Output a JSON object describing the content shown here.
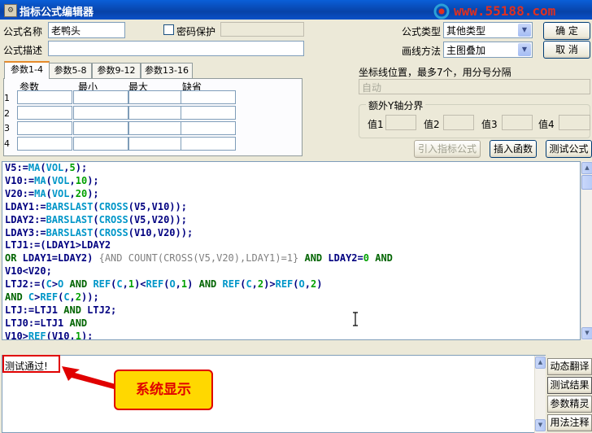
{
  "window": {
    "title": "指标公式编辑器",
    "watermark_url": "www.55188.com"
  },
  "form": {
    "name_label": "公式名称",
    "name_value": "老鸭头",
    "password_label": "密码保护",
    "desc_label": "公式描述",
    "type_label": "公式类型",
    "type_value": "其他类型",
    "draw_label": "画线方法",
    "draw_value": "主图叠加",
    "ok_label": "确  定",
    "cancel_label": "取  消"
  },
  "tabs": [
    "参数1-4",
    "参数5-8",
    "参数9-12",
    "参数13-16"
  ],
  "params": {
    "headers": [
      "参数",
      "最小",
      "最大",
      "缺省"
    ],
    "rows": [
      "1",
      "2",
      "3",
      "4"
    ]
  },
  "axis": {
    "coord_label": "坐标线位置，最多7个，用分号分隔",
    "coord_value": "自动",
    "extra_label": "额外Y轴分界",
    "values": [
      "值1",
      "值2",
      "值3",
      "值4"
    ]
  },
  "actions": {
    "import": "引入指标公式",
    "insert": "插入函数",
    "test": "测试公式"
  },
  "code": [
    [
      {
        "t": "V5:=",
        "c": "id"
      },
      {
        "t": "MA",
        "c": "fn"
      },
      {
        "t": "(",
        "c": "id"
      },
      {
        "t": "VOL",
        "c": "fn"
      },
      {
        "t": ",",
        "c": "id"
      },
      {
        "t": "5",
        "c": "num"
      },
      {
        "t": ");",
        "c": "id"
      }
    ],
    [
      {
        "t": "V10:=",
        "c": "id"
      },
      {
        "t": "MA",
        "c": "fn"
      },
      {
        "t": "(",
        "c": "id"
      },
      {
        "t": "VOL",
        "c": "fn"
      },
      {
        "t": ",",
        "c": "id"
      },
      {
        "t": "10",
        "c": "num"
      },
      {
        "t": ");",
        "c": "id"
      }
    ],
    [
      {
        "t": "V20:=",
        "c": "id"
      },
      {
        "t": "MA",
        "c": "fn"
      },
      {
        "t": "(",
        "c": "id"
      },
      {
        "t": "VOL",
        "c": "fn"
      },
      {
        "t": ",",
        "c": "id"
      },
      {
        "t": "20",
        "c": "num"
      },
      {
        "t": ");",
        "c": "id"
      }
    ],
    [
      {
        "t": "LDAY1:=",
        "c": "id"
      },
      {
        "t": "BARSLAST",
        "c": "fn"
      },
      {
        "t": "(",
        "c": "id"
      },
      {
        "t": "CROSS",
        "c": "fn"
      },
      {
        "t": "(V5,V10));",
        "c": "id"
      }
    ],
    [
      {
        "t": "LDAY2:=",
        "c": "id"
      },
      {
        "t": "BARSLAST",
        "c": "fn"
      },
      {
        "t": "(",
        "c": "id"
      },
      {
        "t": "CROSS",
        "c": "fn"
      },
      {
        "t": "(V5,V20));",
        "c": "id"
      }
    ],
    [
      {
        "t": "LDAY3:=",
        "c": "id"
      },
      {
        "t": "BARSLAST",
        "c": "fn"
      },
      {
        "t": "(",
        "c": "id"
      },
      {
        "t": "CROSS",
        "c": "fn"
      },
      {
        "t": "(V10,V20));",
        "c": "id"
      }
    ],
    [
      {
        "t": "LTJ1:=(LDAY1>LDAY2",
        "c": "id"
      }
    ],
    [
      {
        "t": "OR",
        "c": "kw"
      },
      {
        "t": " LDAY1=LDAY2) ",
        "c": "id"
      },
      {
        "t": "{AND COUNT(CROSS(V5,V20),LDAY1)=1}",
        "c": "cm"
      },
      {
        "t": " ",
        "c": "id"
      },
      {
        "t": "AND",
        "c": "kw"
      },
      {
        "t": " LDAY2=",
        "c": "id"
      },
      {
        "t": "0",
        "c": "num"
      },
      {
        "t": " ",
        "c": "id"
      },
      {
        "t": "AND",
        "c": "kw"
      }
    ],
    [
      {
        "t": "V10<V20;",
        "c": "id"
      }
    ],
    [
      {
        "t": "LTJ2:=(",
        "c": "id"
      },
      {
        "t": "C",
        "c": "fn"
      },
      {
        "t": ">",
        "c": "id"
      },
      {
        "t": "O",
        "c": "fn"
      },
      {
        "t": " ",
        "c": "id"
      },
      {
        "t": "AND",
        "c": "kw"
      },
      {
        "t": " ",
        "c": "id"
      },
      {
        "t": "REF",
        "c": "fn"
      },
      {
        "t": "(",
        "c": "id"
      },
      {
        "t": "C",
        "c": "fn"
      },
      {
        "t": ",",
        "c": "id"
      },
      {
        "t": "1",
        "c": "num"
      },
      {
        "t": ")<",
        "c": "id"
      },
      {
        "t": "REF",
        "c": "fn"
      },
      {
        "t": "(",
        "c": "id"
      },
      {
        "t": "O",
        "c": "fn"
      },
      {
        "t": ",",
        "c": "id"
      },
      {
        "t": "1",
        "c": "num"
      },
      {
        "t": ") ",
        "c": "id"
      },
      {
        "t": "AND",
        "c": "kw"
      },
      {
        "t": " ",
        "c": "id"
      },
      {
        "t": "REF",
        "c": "fn"
      },
      {
        "t": "(",
        "c": "id"
      },
      {
        "t": "C",
        "c": "fn"
      },
      {
        "t": ",",
        "c": "id"
      },
      {
        "t": "2",
        "c": "num"
      },
      {
        "t": ")>",
        "c": "id"
      },
      {
        "t": "REF",
        "c": "fn"
      },
      {
        "t": "(",
        "c": "id"
      },
      {
        "t": "O",
        "c": "fn"
      },
      {
        "t": ",",
        "c": "id"
      },
      {
        "t": "2",
        "c": "num"
      },
      {
        "t": ")",
        "c": "id"
      }
    ],
    [
      {
        "t": "AND",
        "c": "kw"
      },
      {
        "t": " ",
        "c": "id"
      },
      {
        "t": "C",
        "c": "fn"
      },
      {
        "t": ">",
        "c": "id"
      },
      {
        "t": "REF",
        "c": "fn"
      },
      {
        "t": "(",
        "c": "id"
      },
      {
        "t": "C",
        "c": "fn"
      },
      {
        "t": ",",
        "c": "id"
      },
      {
        "t": "2",
        "c": "num"
      },
      {
        "t": "));",
        "c": "id"
      }
    ],
    [
      {
        "t": "LTJ:=LTJ1 ",
        "c": "id"
      },
      {
        "t": "AND",
        "c": "kw"
      },
      {
        "t": " LTJ2;",
        "c": "id"
      }
    ],
    [
      {
        "t": "LTJ0:=LTJ1 ",
        "c": "id"
      },
      {
        "t": "AND",
        "c": "kw"
      }
    ],
    [
      {
        "t": "V10>",
        "c": "id"
      },
      {
        "t": "REF",
        "c": "fn"
      },
      {
        "t": "(V10,",
        "c": "id"
      },
      {
        "t": "1",
        "c": "num"
      },
      {
        "t": ");",
        "c": "id"
      }
    ]
  ],
  "output": {
    "text": "测试通过!"
  },
  "callout": {
    "text": "系统显示"
  },
  "side_tabs": [
    "动态翻译",
    "测试结果",
    "参数精灵",
    "用法注释"
  ]
}
